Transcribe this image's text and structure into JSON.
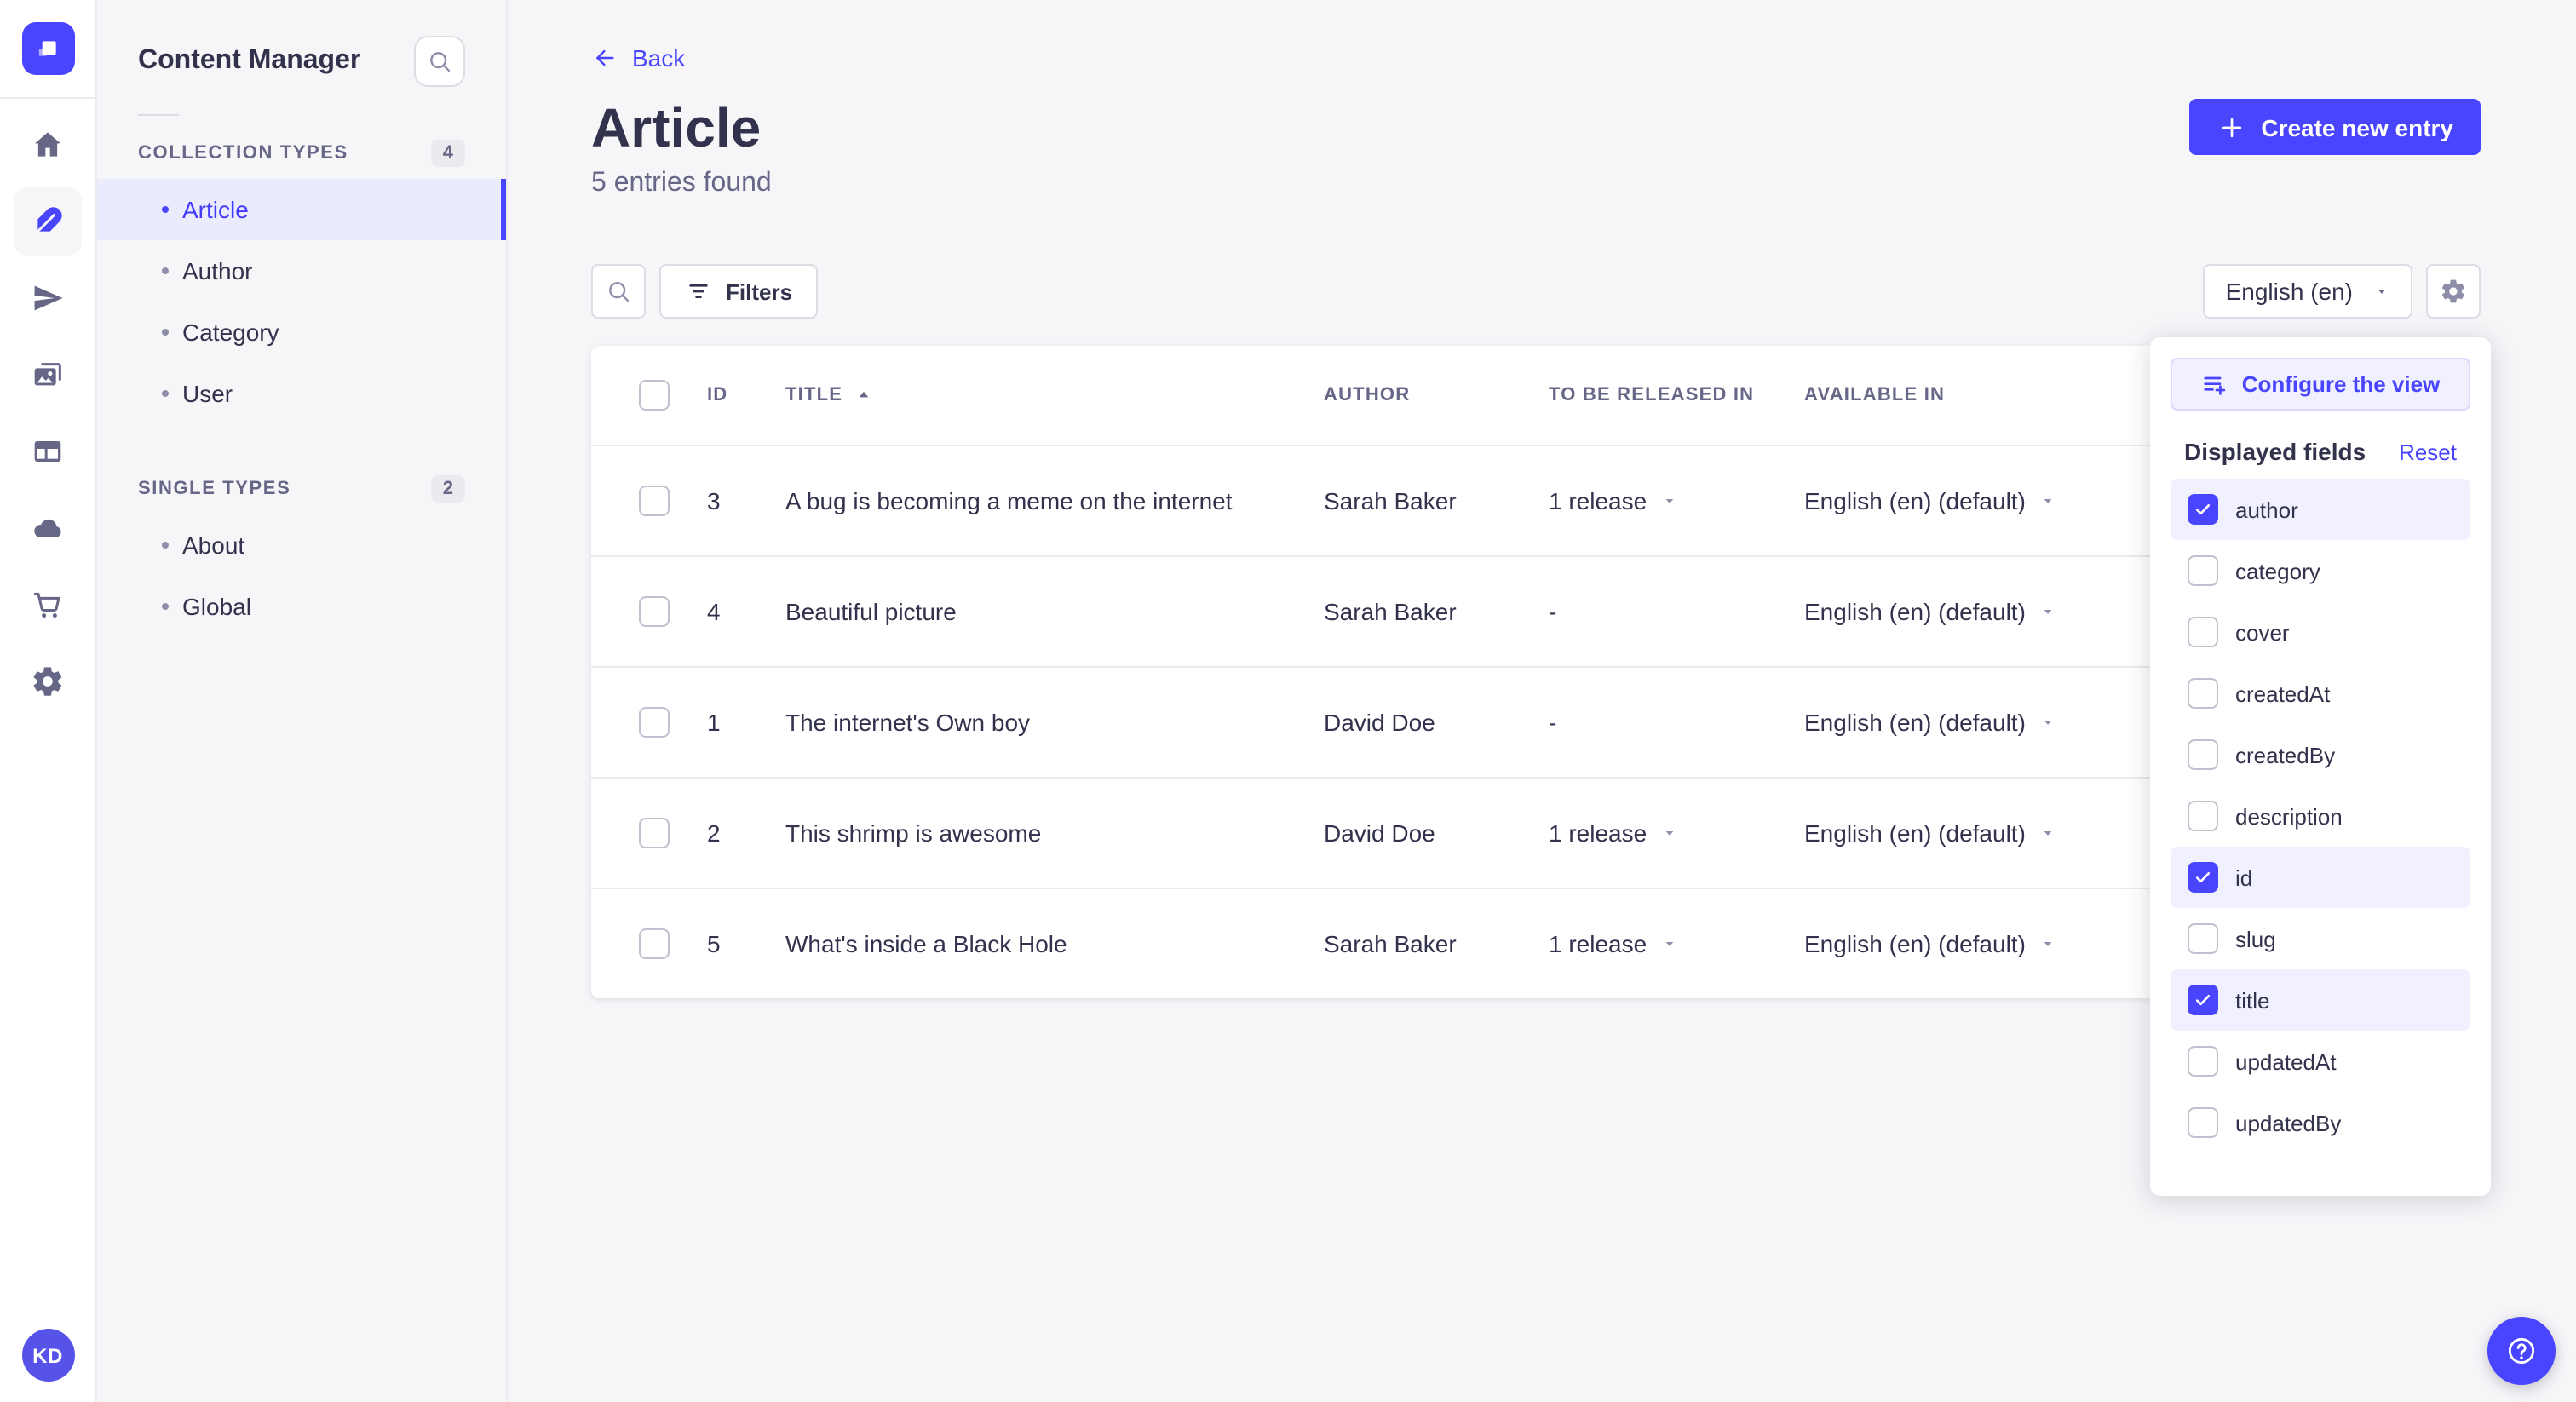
{
  "colors": {
    "accent": "#4945ff",
    "accent_light": "#f0f0ff",
    "accent_border": "#d9d8ff",
    "background": "#f6f6f9",
    "surface": "#ffffff",
    "border": "#eaeaef",
    "input_border": "#dcdce4",
    "text_primary": "#32324d",
    "text_secondary": "#666687",
    "icon_muted": "#8e8ea9"
  },
  "rail": {
    "logo_icon": "strapi-logo",
    "items": [
      {
        "icon": "home-icon",
        "active": false
      },
      {
        "icon": "feather-icon",
        "active": true
      },
      {
        "icon": "paper-plane-icon",
        "active": false
      },
      {
        "icon": "media-library-icon",
        "active": false
      },
      {
        "icon": "layout-icon",
        "active": false
      },
      {
        "icon": "cloud-icon",
        "active": false
      },
      {
        "icon": "cart-icon",
        "active": false
      },
      {
        "icon": "gear-icon",
        "active": false
      }
    ],
    "avatar_initials": "KD"
  },
  "sidebar": {
    "title": "Content Manager",
    "sections": [
      {
        "label": "COLLECTION TYPES",
        "count": "4",
        "items": [
          {
            "label": "Article",
            "active": true
          },
          {
            "label": "Author",
            "active": false
          },
          {
            "label": "Category",
            "active": false
          },
          {
            "label": "User",
            "active": false
          }
        ]
      },
      {
        "label": "SINGLE TYPES",
        "count": "2",
        "items": [
          {
            "label": "About",
            "active": false
          },
          {
            "label": "Global",
            "active": false
          }
        ]
      }
    ]
  },
  "header": {
    "back_label": "Back",
    "title": "Article",
    "subtitle": "5 entries found",
    "create_label": "Create new entry"
  },
  "toolbar": {
    "filters_label": "Filters",
    "locale_value": "English (en)"
  },
  "table": {
    "headers": {
      "id": "ID",
      "title": "TITLE",
      "author": "AUTHOR",
      "released": "TO BE RELEASED IN",
      "available": "AVAILABLE IN"
    },
    "sort": {
      "column": "TITLE",
      "direction": "ascending"
    },
    "rows": [
      {
        "id": "3",
        "title": "A bug is becoming a meme on the internet",
        "author": "Sarah Baker",
        "released": "1 release",
        "released_caret": true,
        "available": "English (en) (default)",
        "available_caret": true
      },
      {
        "id": "4",
        "title": "Beautiful picture",
        "author": "Sarah Baker",
        "released": "-",
        "released_caret": false,
        "available": "English (en) (default)",
        "available_caret": true
      },
      {
        "id": "1",
        "title": "The internet's Own boy",
        "author": "David Doe",
        "released": "-",
        "released_caret": false,
        "available": "English (en) (default)",
        "available_caret": true
      },
      {
        "id": "2",
        "title": "This shrimp is awesome",
        "author": "David Doe",
        "released": "1 release",
        "released_caret": true,
        "available": "English (en) (default)",
        "available_caret": true
      },
      {
        "id": "5",
        "title": "What's inside a Black Hole",
        "author": "Sarah Baker",
        "released": "1 release",
        "released_caret": true,
        "available": "English (en) (default)",
        "available_caret": true
      }
    ]
  },
  "popover": {
    "configure_label": "Configure the view",
    "fields_title": "Displayed fields",
    "reset_label": "Reset",
    "fields": [
      {
        "label": "author",
        "checked": true
      },
      {
        "label": "category",
        "checked": false
      },
      {
        "label": "cover",
        "checked": false
      },
      {
        "label": "createdAt",
        "checked": false
      },
      {
        "label": "createdBy",
        "checked": false
      },
      {
        "label": "description",
        "checked": false
      },
      {
        "label": "id",
        "checked": true
      },
      {
        "label": "slug",
        "checked": false
      },
      {
        "label": "title",
        "checked": true
      },
      {
        "label": "updatedAt",
        "checked": false
      },
      {
        "label": "updatedBy",
        "checked": false
      }
    ]
  }
}
